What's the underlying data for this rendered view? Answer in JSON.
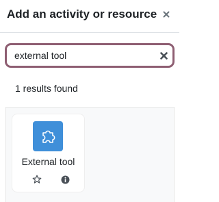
{
  "dialog": {
    "title": "Add an activity or resource",
    "close_icon": "close-icon"
  },
  "search": {
    "value": "external tool",
    "clear_icon": "clear-icon"
  },
  "results": {
    "count_text": "1 results found",
    "items": [
      {
        "label": "External tool",
        "icon": "puzzle-piece-icon",
        "star_icon": "star-outline-icon",
        "info_icon": "info-icon"
      }
    ]
  },
  "colors": {
    "search_border": "#8e5e72",
    "tool_icon_bg": "#3f8fd9",
    "results_bg": "#f8f9fa",
    "text": "#1d2125"
  }
}
